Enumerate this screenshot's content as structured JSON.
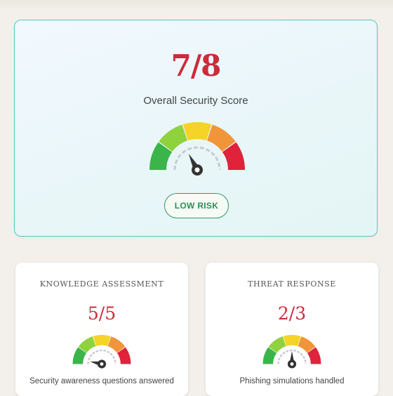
{
  "overall": {
    "score": "7/8",
    "label": "Overall Security Score",
    "risk_badge": "LOW RISK"
  },
  "cards": [
    {
      "title": "KNOWLEDGE ASSESSMENT",
      "score": "5/5",
      "caption": "Security awareness questions answered"
    },
    {
      "title": "THREAT RESPONSE",
      "score": "2/3",
      "caption": "Phishing simulations handled"
    }
  ],
  "gauge_colors": [
    "#3bb54a",
    "#8ed23e",
    "#f5d327",
    "#f0953a",
    "#e0223b"
  ],
  "colors": {
    "score_red": "#cc2b3a",
    "low_risk_green": "#2b8f58",
    "card_border_teal": "#58c9c4"
  }
}
